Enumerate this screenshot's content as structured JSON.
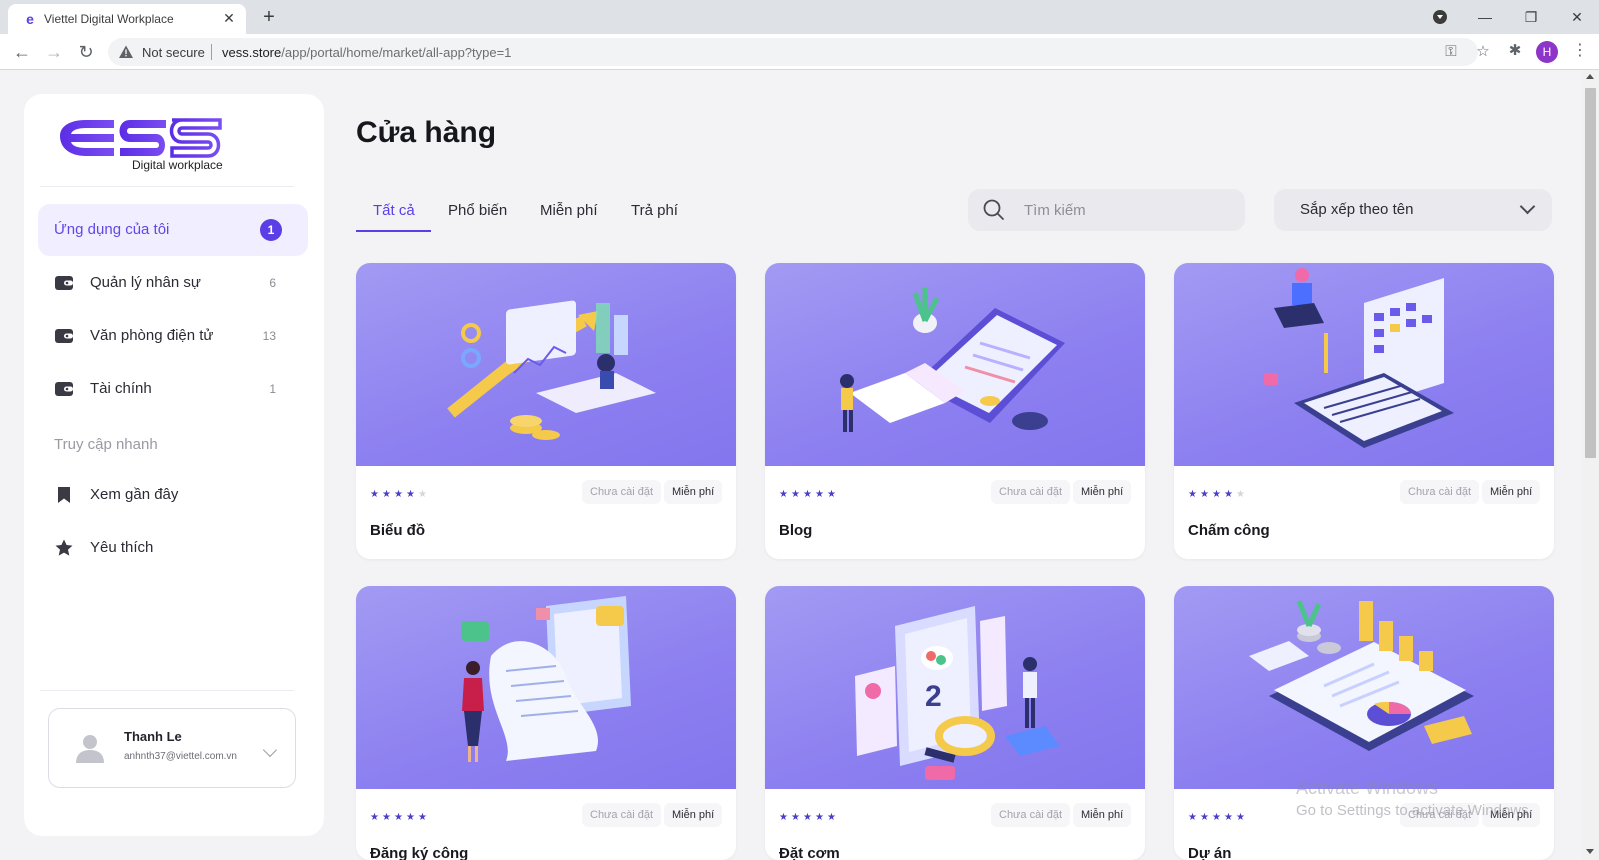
{
  "browser": {
    "tab_title": "Viettel Digital Workplace",
    "not_secure": "Not secure",
    "url_host": "vess.store",
    "url_path": "/app/portal/home/market/all-app?type=1",
    "profile_initial": "H"
  },
  "sidebar": {
    "logo_text": "ess",
    "logo_subtitle": "Digital workplace",
    "active_item": {
      "label": "Ứng dụng của tôi",
      "badge": "1"
    },
    "groups": [
      {
        "label": "Quản lý nhân sự",
        "count": "6"
      },
      {
        "label": "Văn phòng điện tử",
        "count": "13"
      },
      {
        "label": "Tài chính",
        "count": "1"
      }
    ],
    "quick_access_title": "Truy cập nhanh",
    "quick_items": [
      {
        "label": "Xem gần đây",
        "icon": "bookmark-icon"
      },
      {
        "label": "Yêu thích",
        "icon": "star-icon"
      }
    ],
    "user": {
      "name": "Thanh Le",
      "email": "anhnth37@viettel.com.vn"
    }
  },
  "main": {
    "title": "Cửa hàng",
    "tabs": [
      "Tất cả",
      "Phổ biến",
      "Miễn phí",
      "Trả phí"
    ],
    "active_tab": "Tất cả",
    "search_placeholder": "Tìm kiếm",
    "sort_label": "Sắp xếp theo tên",
    "cards": [
      {
        "title": "Biểu đồ",
        "rating": 4,
        "status": "Chưa cài đặt",
        "price": "Miễn phí"
      },
      {
        "title": "Blog",
        "rating": 5,
        "status": "Chưa cài đặt",
        "price": "Miễn phí"
      },
      {
        "title": "Chấm công",
        "rating": 4,
        "status": "Chưa cài đặt",
        "price": "Miễn phí"
      },
      {
        "title": "Đăng ký công",
        "rating": 5,
        "status": "Chưa cài đặt",
        "price": "Miễn phí"
      },
      {
        "title": "Đặt cơm",
        "rating": 5,
        "status": "Chưa cài đặt",
        "price": "Miễn phí"
      },
      {
        "title": "Dự án",
        "rating": 5,
        "status": "Chưa cài đặt",
        "price": "Miễn phí"
      }
    ]
  },
  "overlay": {
    "activate_line1": "Activate Windows",
    "activate_line2": "Go to Settings to activate Windows."
  },
  "colors": {
    "accent": "#5b3ee6",
    "card_bg": "#8c7ff0",
    "page_bg": "#f3f3f5"
  }
}
